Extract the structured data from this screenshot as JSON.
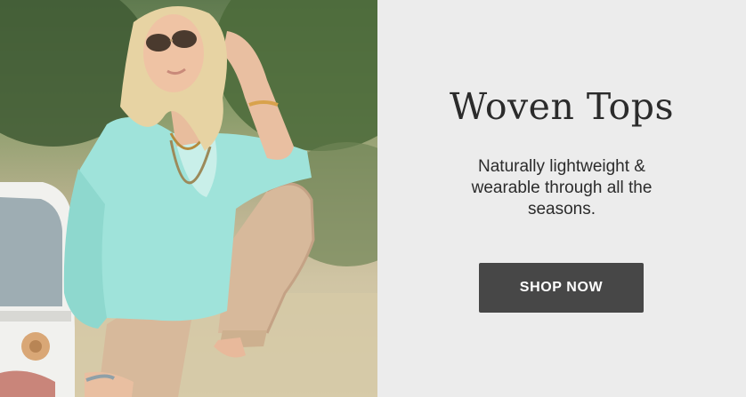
{
  "promo": {
    "heading": "Woven Tops",
    "subtext": "Naturally lightweight & wearable through all the seasons.",
    "cta_label": "SHOP NOW"
  },
  "colors": {
    "panel_bg": "#ececec",
    "text": "#2b2b2b",
    "button_bg": "#474747",
    "button_text": "#ffffff"
  }
}
